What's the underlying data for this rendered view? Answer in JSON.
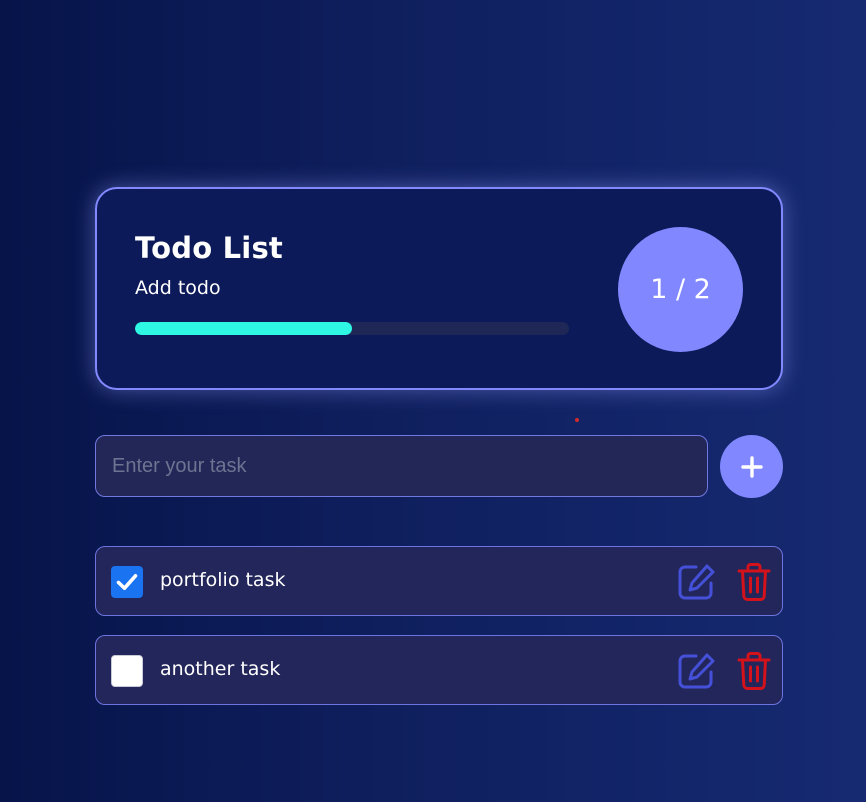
{
  "header": {
    "title": "Todo List",
    "subtitle": "Add todo",
    "progress": 0.5,
    "counter": "1 / 2"
  },
  "input": {
    "placeholder": "Enter your task",
    "value": ""
  },
  "add_button": {
    "icon": "plus-icon"
  },
  "todos": [
    {
      "text": "portfolio task",
      "completed": true
    },
    {
      "text": "another task",
      "completed": false
    }
  ],
  "icons": {
    "edit": "edit-icon",
    "delete": "trash-icon",
    "check": "checkmark-icon"
  },
  "colors": {
    "accent": "#8087ff",
    "progress": "#2ef7e4",
    "checkbox_checked": "#1a73f0",
    "edit_icon": "#4450d8",
    "delete_icon": "#d3121b",
    "background_start": "#07144a",
    "background_end": "#162a72"
  }
}
